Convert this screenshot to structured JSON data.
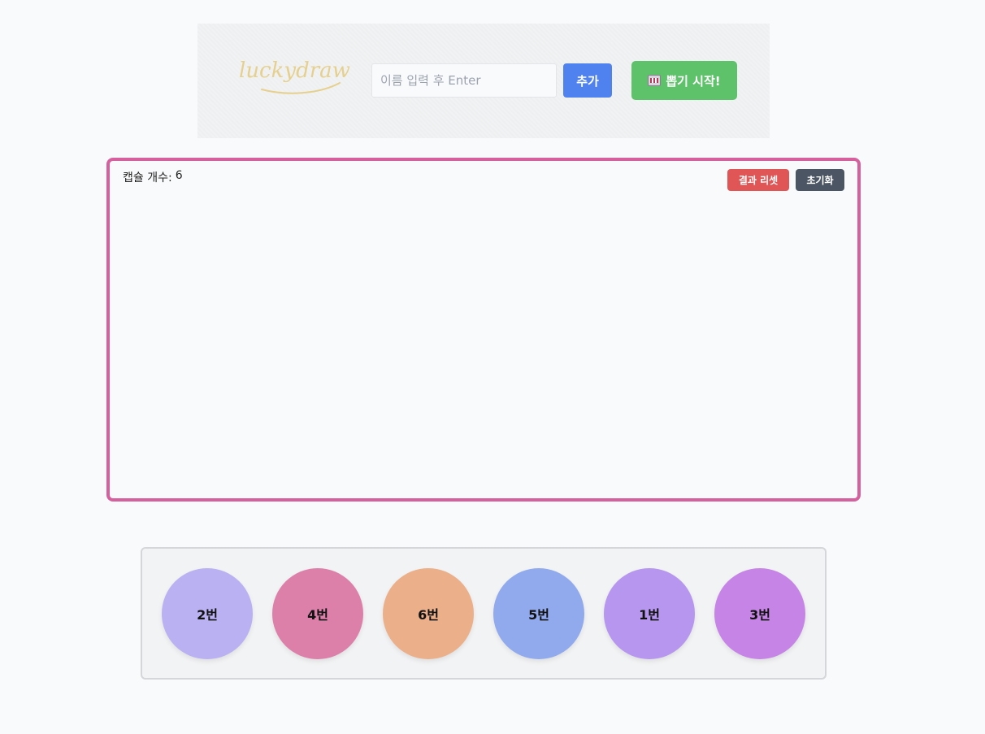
{
  "header": {
    "logo_text": "luckydraw",
    "name_input_placeholder": "이름 입력 후 Enter",
    "name_input_value": "",
    "add_label": "추가",
    "start_label": "뽑기 시작!",
    "start_icon": "slot-machine-icon"
  },
  "arena": {
    "capsule_count_label": "캡슐 개수:",
    "capsule_count": "6",
    "reset_result_label": "결과 리셋",
    "init_label": "초기화",
    "border_color": "#d6609e"
  },
  "results": {
    "balls": [
      {
        "label": "2번",
        "color": "#b9b1f2"
      },
      {
        "label": "4번",
        "color": "#dc80aa"
      },
      {
        "label": "6번",
        "color": "#ebaf8a"
      },
      {
        "label": "5번",
        "color": "#91aaee"
      },
      {
        "label": "1번",
        "color": "#b696ee"
      },
      {
        "label": "3번",
        "color": "#c685e6"
      }
    ]
  },
  "colors": {
    "add_button": "#4f82ee",
    "start_button": "#5ec26a",
    "reset_button": "#e05555",
    "init_button": "#4b5563"
  }
}
